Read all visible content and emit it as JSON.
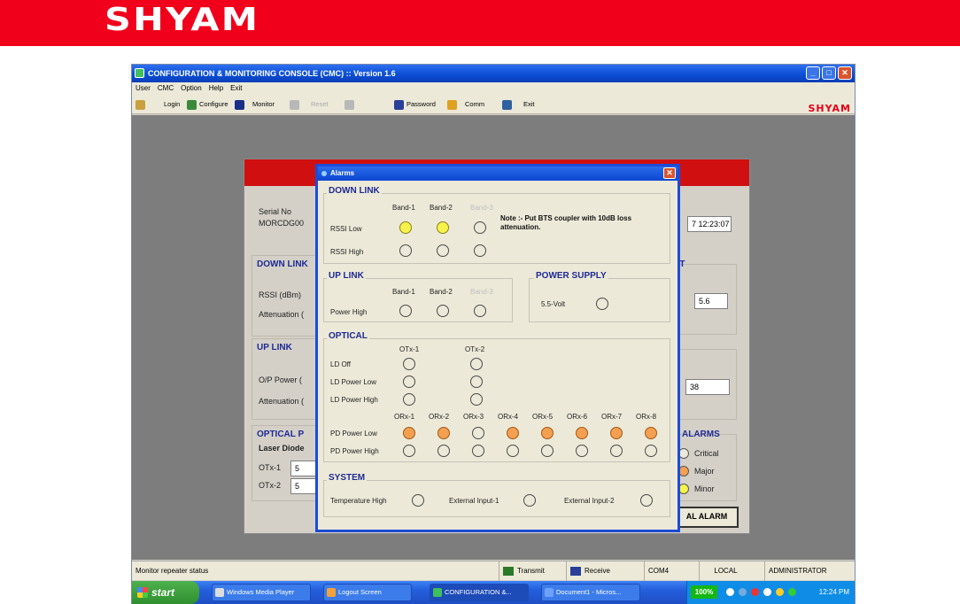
{
  "brand": {
    "logo": "SHYAM"
  },
  "window": {
    "title": "CONFIGURATION & MONITORING CONSOLE (CMC) :: Version 1.6",
    "buttons": {
      "minimize": "_",
      "maximize": "□",
      "close": "✕"
    }
  },
  "menu": [
    "User",
    "CMC",
    "Option",
    "Help",
    "Exit"
  ],
  "toolbar": {
    "login": "Login",
    "configure": "Configure",
    "monitor": "Monitor",
    "reset": "Reset",
    "password": "Password",
    "comm": "Comm",
    "exit": "Exit",
    "brand": "SHYAM"
  },
  "form": {
    "serial_label": "Serial No",
    "serial_value": "MORCDG00",
    "datetime": "7 12:23:07",
    "downlink_title": "DOWN LINK",
    "rssi_label": "RSSI (dBm)",
    "atten_label": "Attenuation (",
    "downlink_right_title": "LT",
    "downlink_value": "5.6",
    "uplink_title": "UP LINK",
    "op_power_label": "O/P Power (",
    "atten2_label": "Attenuation (",
    "uplink_value": "38",
    "optical_title": "OPTICAL P",
    "laser_label": "Laser Diode",
    "otx1": "OTx-1",
    "otx1_val": "5",
    "otx2": "OTx-2",
    "otx2_val": "5",
    "alarms_title": "ALARMS",
    "critical": "Critical",
    "major": "Major",
    "minor": "Minor",
    "all_alarm_btn": "AL ALARM"
  },
  "alarms": {
    "title": "Alarms",
    "downlink": {
      "title": "DOWN LINK",
      "bands": [
        "Band-1",
        "Band-2",
        "Band-3"
      ],
      "rows": [
        "RSSI Low",
        "RSSI High"
      ],
      "note": "Note :- Put BTS coupler with 10dB loss attenuation."
    },
    "uplink": {
      "title": "UP LINK",
      "bands": [
        "Band-1",
        "Band-2",
        "Band-3"
      ],
      "row": "Power High"
    },
    "power_supply": {
      "title": "POWER SUPPLY",
      "row": "5.5-Volt"
    },
    "optical": {
      "title": "OPTICAL",
      "otx": [
        "OTx-1",
        "OTx-2"
      ],
      "otx_rows": [
        "LD Off",
        "LD Power Low",
        "LD Power High"
      ],
      "orx": [
        "ORx-1",
        "ORx-2",
        "ORx-3",
        "ORx-4",
        "ORx-5",
        "ORx-6",
        "ORx-7",
        "ORx-8"
      ],
      "orx_rows": [
        "PD Power Low",
        "PD Power High"
      ]
    },
    "system": {
      "title": "SYSTEM",
      "items": [
        "Temperature High",
        "External Input-1",
        "External Input-2"
      ]
    }
  },
  "status": {
    "message": "Monitor repeater status",
    "transmit": "Transmit",
    "receive": "Receive",
    "port": "COM4",
    "mode": "LOCAL",
    "user": "ADMINISTRATOR"
  },
  "taskbar": {
    "start": "start",
    "tasks": [
      "Windows Media Player",
      "Logout Screen",
      "CONFIGURATION &...",
      "Document1 - Micros..."
    ],
    "zoom": "100%",
    "clock": "12:24 PM"
  },
  "colors": {
    "brand_red": "#f0001a",
    "led_yellow": "#f7f34a",
    "led_orange": "#f4a050",
    "section_blue": "#1e2a96"
  }
}
